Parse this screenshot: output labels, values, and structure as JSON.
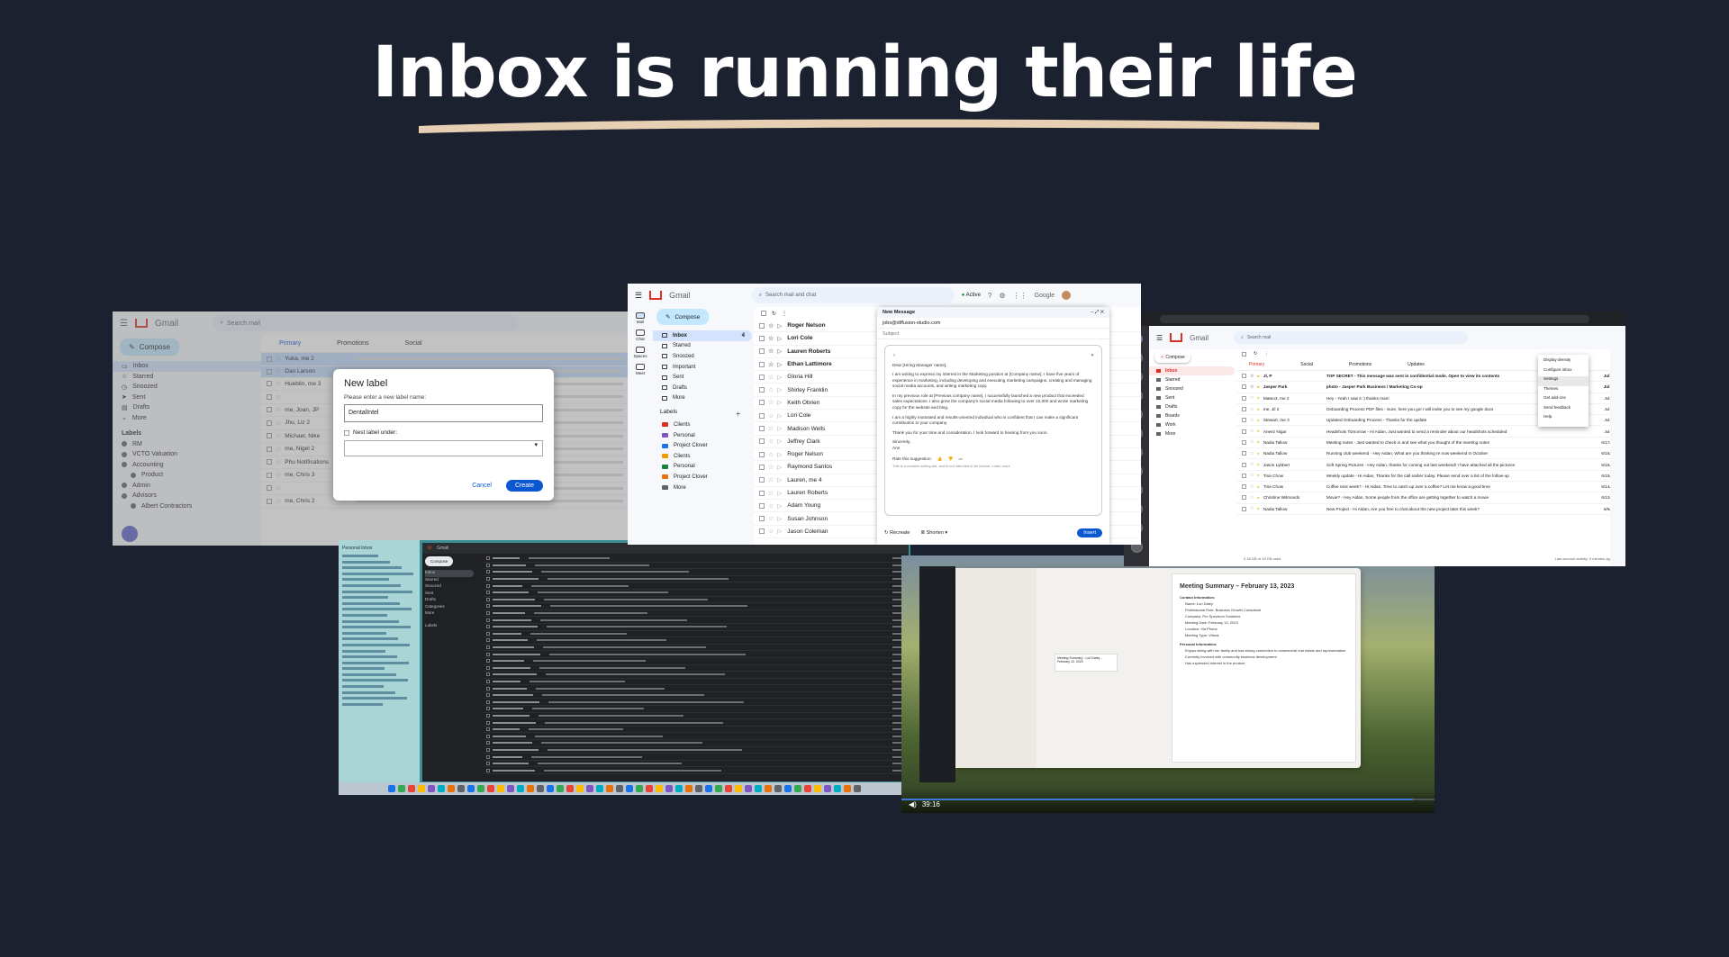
{
  "slide": {
    "title": "Inbox is running their life",
    "underline_color": "#e6cfb2",
    "background": "#1c2130"
  },
  "shot1": {
    "app_name": "Gmail",
    "search_placeholder": "Search mail",
    "compose_label": "Compose",
    "nav_items": [
      "Inbox",
      "Starred",
      "Snoozed",
      "Sent",
      "Drafts",
      "More"
    ],
    "labels_header": "Labels",
    "labels": [
      "RM",
      "VCTO Valuation",
      "Accounting",
      "Product",
      "Admin",
      "Advisors",
      "Albert Contractors"
    ],
    "tabs": [
      "Primary",
      "Promotions",
      "Social"
    ],
    "rows": [
      "Yuka, me 2",
      "Dan Larson",
      "Hueblin, me 3",
      "",
      "me, Joan, JP",
      "Jhu, Liz 2",
      "Michael, Nike",
      "me, Nigel 2",
      "Phu Notifications",
      "me, Chris 3",
      "",
      "me, Chris 2"
    ],
    "modal": {
      "title": "New label",
      "prompt": "Please enter a new label name:",
      "input_value": "DentalIntel",
      "nest_label": "Nest label under:",
      "cancel": "Cancel",
      "create": "Create"
    }
  },
  "shot2": {
    "app_name": "Gmail",
    "search_placeholder": "Search mail and chat",
    "status": "Active",
    "brand": "Google",
    "compose_label": "Compose",
    "rail": [
      "Mail",
      "Chat",
      "Spaces",
      "Meet"
    ],
    "nav": [
      {
        "label": "Inbox",
        "count": "4"
      },
      {
        "label": "Starred",
        "count": ""
      },
      {
        "label": "Snoozed",
        "count": ""
      },
      {
        "label": "Important",
        "count": ""
      },
      {
        "label": "Sent",
        "count": ""
      },
      {
        "label": "Drafts",
        "count": ""
      },
      {
        "label": "More",
        "count": ""
      }
    ],
    "labels_header": "Labels",
    "labels": [
      {
        "name": "Clients",
        "color": "#d93025"
      },
      {
        "name": "Personal",
        "color": "#7e57c2"
      },
      {
        "name": "Project Clover",
        "color": "#1a73e8"
      },
      {
        "name": "Clients",
        "color": "#f29900"
      },
      {
        "name": "Personal",
        "color": "#188038"
      },
      {
        "name": "Project Clover",
        "color": "#e8710a"
      },
      {
        "name": "More",
        "color": "#5f6368"
      }
    ],
    "senders": [
      "Roger Nelson",
      "Lori Cole",
      "Lauren Roberts",
      "Ethan Lattimore",
      "Gloria Hill",
      "Shirley Franklin",
      "Keith Obrien",
      "Lori Cole",
      "Madison Wells",
      "Jeffrey Clark",
      "Roger Nelson",
      "Raymond Santos",
      "Lauren, me 4",
      "Lauren Roberts",
      "Adam Young",
      "Susan Johnson",
      "Jason Coleman"
    ],
    "compose_window": {
      "header": "New Message",
      "to": "jobs@diffusion-studio.com",
      "subject": "Subject",
      "greeting": "Dear [Hiring Manager name],",
      "p1": "I am writing to express my interest in the Marketing position at [Company name]. I have five years of experience in marketing, including developing and executing marketing campaigns, creating and managing social media accounts, and writing marketing copy.",
      "p2": "In my previous role at [Previous company name], I successfully launched a new product that exceeded sales expectations. I also grew the company's social media following to over 10,000 and wrote marketing copy for the website and blog.",
      "p3": "I am a highly motivated and results-oriented individual who is confident that I can make a significant contribution to your company.",
      "p4": "Thank you for your time and consideration. I look forward to hearing from you soon.",
      "sign": "Sincerely,",
      "name": "Ann",
      "rate": "Rate this suggestion:",
      "note": "This is a creative writing aid, and is not intended to be factual. Learn more",
      "recreate": "Recreate",
      "shorten": "Shorten",
      "insert": "Insert"
    }
  },
  "shot3": {
    "app_name": "Gmail",
    "search_placeholder": "Search mail",
    "compose_label": "Compose",
    "nav": [
      "Inbox",
      "Starred",
      "Snoozed",
      "Sent",
      "Drafts",
      "Boards",
      "Work",
      "More"
    ],
    "tabs": [
      "Primary",
      "Social",
      "Promotions",
      "Updates"
    ],
    "menu": [
      "Display density",
      "Configure inbox",
      "Settings",
      "Themes",
      "Get add-ons",
      "Send feedback",
      "Help"
    ],
    "rows": [
      {
        "from": "Jl, P",
        "subject": "TOP SECRET - This message was sent in confidential mode. Open to view its contents"
      },
      {
        "from": "Jasper Park",
        "subject": "photo - Jasper Park Business / Marketing Co-op"
      },
      {
        "from": "Mateo3, me 2",
        "subject": "Hey - Yeah I saw it :) thanks man!"
      },
      {
        "from": "me, Jil 2",
        "subject": "Onboarding Process PDF files - Sure, here you go! I will invite you to see my google docs"
      },
      {
        "from": "Stewart, me 3",
        "subject": "Updated Onboarding Process - Thanks for the update"
      },
      {
        "from": "Aneez Nigar",
        "subject": "Headshots Tomorrow - Hi Aidan, Just wanted to send a reminder about our headshots scheduled"
      },
      {
        "from": "Nadia Tallow",
        "subject": "Meeting notes - Just wanted to check in and see what you thought of the meeting notes"
      },
      {
        "from": "Nadia Tallow",
        "subject": "Running club weekend - Hey Aidan, What are you thinking re now weekend in October"
      },
      {
        "from": "Jason Lybbert",
        "subject": "Soft Spring Pictures - Hey Aidan, thanks for coming out last weekend! I have attached all the pictures"
      },
      {
        "from": "Tina Chow",
        "subject": "Weekly update - Hi Aidan, Thanks for the call earlier today. Please send over a list of the follow-up"
      },
      {
        "from": "Tina Chow",
        "subject": "Coffee next week? - Hi Aidan, Time to catch up over a coffee? Let me know a good time"
      },
      {
        "from": "Christine Wilmonds",
        "subject": "Movie? - Hey Aidan, Some people from the office are getting together to watch a movie"
      },
      {
        "from": "Nadia Tallow",
        "subject": "New Project - Hi Aidan, Are you free to chat about the new project later this week?"
      }
    ],
    "dates": [
      "Jul 26",
      "Jul 26",
      "Jul 26",
      "Jul 26",
      "Jul 25",
      "Jul 25",
      "6/17/22",
      "6/16/22",
      "6/15/22",
      "6/15/22",
      "6/14/22",
      "6/13/22",
      "6/6/22"
    ],
    "footer_left": "0.18 GB of 15 GB used",
    "footer_right": "Last account activity: 0 minutes ago"
  },
  "shot4": {
    "app_name": "Gmail",
    "compose_label": "Compose",
    "nav": [
      "Inbox",
      "Starred",
      "Snoozed",
      "Sent",
      "Drafts",
      "Categories",
      "More"
    ],
    "labels_header": "Labels",
    "sidebar_title": "Personal Inbox"
  },
  "shot5": {
    "chat_prompt_title": "Meeting Summary - Lori Daley - February 13, 2023",
    "doc_title": "Meeting Summary – February 13, 2023",
    "contact_header": "Contact Information:",
    "contact_lines": [
      "Name: Lori Daley",
      "Professional Role: Business Growth Consultant",
      "Company: Pro Spectrum Solutions",
      "Meeting Date: February 13, 2023",
      "Location: Via Phone",
      "Meeting Type: Virtual"
    ],
    "personal_header": "Personal Information:",
    "personal_lines": [
      "Enjoys skiing with her family and has strong connection to commercial real estate and representation",
      "Currently involved with community business development",
      "Has expressed interest in the product"
    ],
    "timestamp": "39:16"
  }
}
